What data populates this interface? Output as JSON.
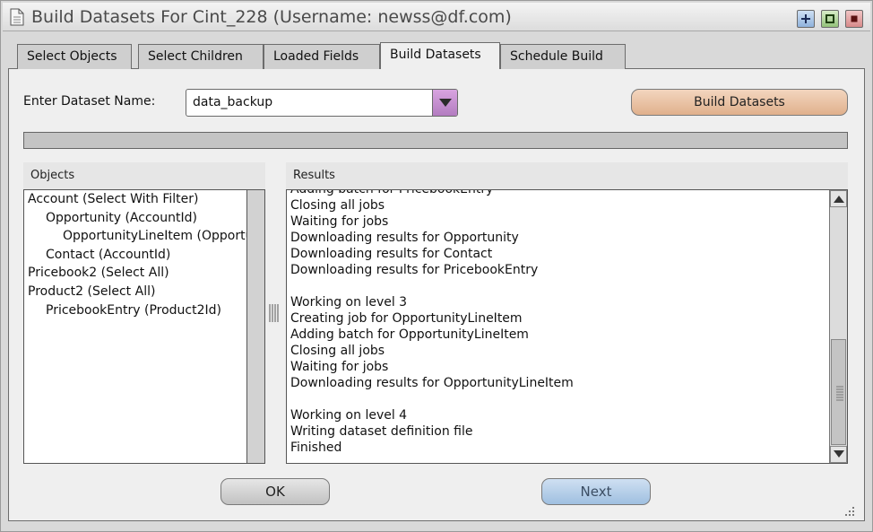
{
  "window": {
    "title": "Build Datasets For Cint_228 (Username: newss@df.com)"
  },
  "tabs": [
    {
      "label": "Select Objects",
      "active": false
    },
    {
      "label": "Select Children",
      "active": false
    },
    {
      "label": "Loaded Fields",
      "active": false
    },
    {
      "label": "Build Datasets",
      "active": true
    },
    {
      "label": "Schedule Build",
      "active": false
    }
  ],
  "form": {
    "dataset_label": "Enter Dataset Name:",
    "dataset_value": "data_backup",
    "build_button": "Build Datasets"
  },
  "progress": {
    "value": 0
  },
  "objects": {
    "header": "Objects",
    "items": [
      {
        "label": "Account (Select With Filter)",
        "level": 0
      },
      {
        "label": "Opportunity (AccountId)",
        "level": 1
      },
      {
        "label": "OpportunityLineItem (Opportu",
        "level": 2
      },
      {
        "label": "Contact (AccountId)",
        "level": 1
      },
      {
        "label": "Pricebook2 (Select All)",
        "level": 0
      },
      {
        "label": "Product2 (Select All)",
        "level": 0
      },
      {
        "label": "PricebookEntry (Product2Id)",
        "level": 1
      }
    ]
  },
  "results": {
    "header": "Results",
    "lines": [
      "Adding batch for PricebookEntry",
      "Closing all jobs",
      "Waiting for jobs",
      "Downloading results for Opportunity",
      "Downloading results for Contact",
      "Downloading results for PricebookEntry",
      "",
      "Working on level 3",
      "Creating job for OpportunityLineItem",
      "Adding batch for OpportunityLineItem",
      "Closing all jobs",
      "Waiting for jobs",
      "Downloading results for OpportunityLineItem",
      "",
      "Working on level 4",
      "Writing dataset definition file",
      "Finished"
    ]
  },
  "footer": {
    "ok_button": "OK",
    "next_button": "Next"
  },
  "colors": {
    "build_button": "#e4b896",
    "next_button": "#b4cde8",
    "dropdown_arrow": "#c08ccc"
  }
}
